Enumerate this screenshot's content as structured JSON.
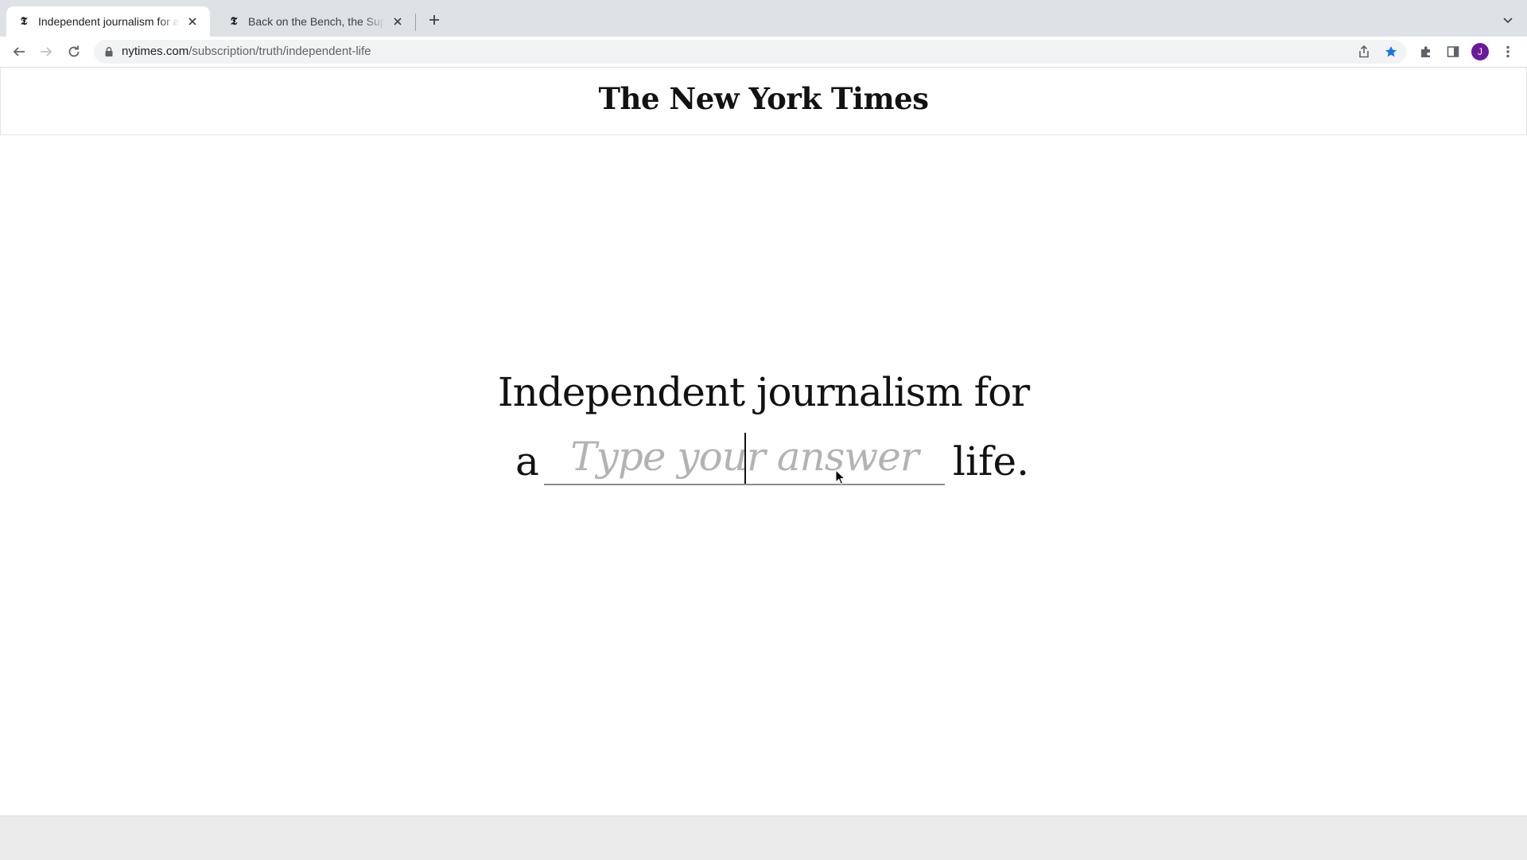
{
  "browser": {
    "tabs": [
      {
        "title": "Independent journalism for an independent life",
        "active": true,
        "favicon": "nyt-favicon"
      },
      {
        "title": "Back on the Bench, the Supreme Court",
        "active": false,
        "favicon": "nyt-favicon"
      }
    ],
    "favicon_glyph": "𝕿",
    "address": {
      "host": "nytimes.com",
      "path": "/subscription/truth/independent-life"
    },
    "profile_initial": "J",
    "colors": {
      "tabstrip": "#dee1e6",
      "avatar": "#6a1b9a",
      "bookmark_star": "#1a73e8"
    }
  },
  "page": {
    "logo": "The New York Times",
    "headline": "Independent journalism for",
    "prefix": "a",
    "answer_placeholder": "Type your answer",
    "answer_value": "",
    "suffix": "life."
  }
}
